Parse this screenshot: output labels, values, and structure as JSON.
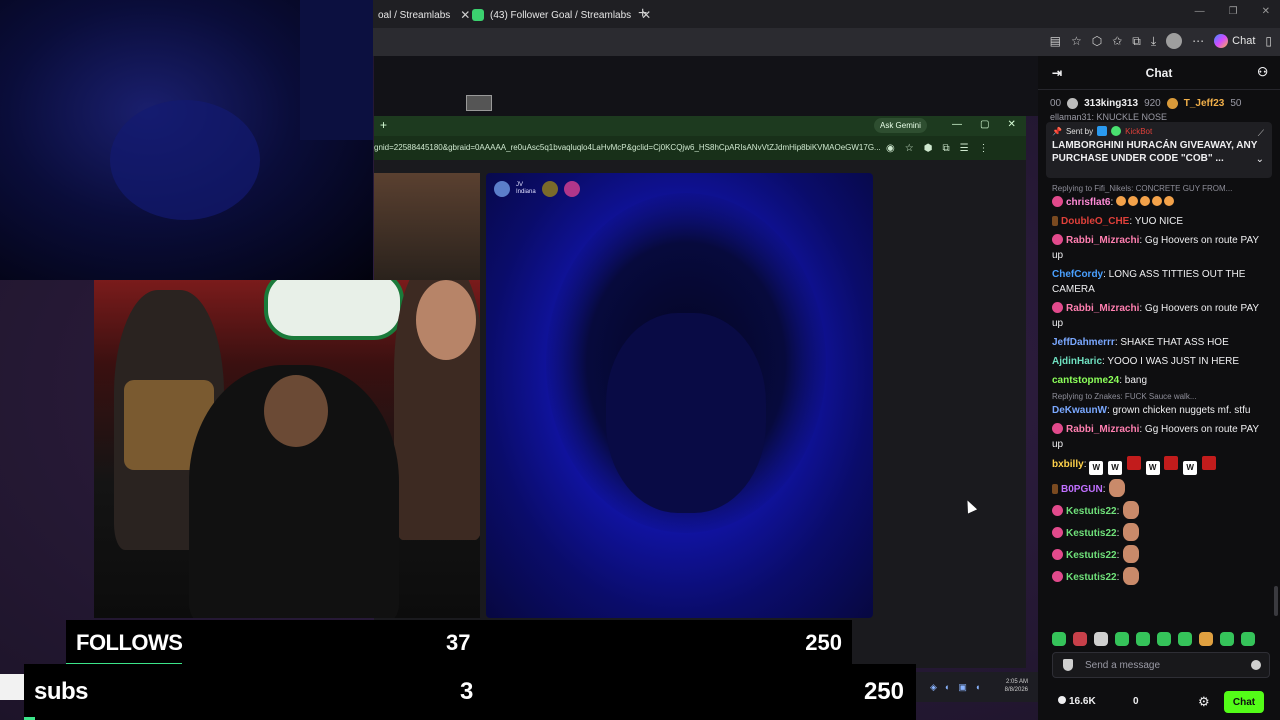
{
  "browser": {
    "tabs": [
      {
        "label": "oal / Streamlabs"
      },
      {
        "label": "(43) Follower Goal / Streamlabs"
      }
    ],
    "copilot_label": "Chat"
  },
  "inner_browser": {
    "gemini_label": "Ask Gemini",
    "url": "gnid=22588445180&gbraid=0AAAAA_re0uAsc5q1bvaqluqlo4LaHvMcP&gclid=Cj0KCQjw6_HS8hCpARIsANvVtZJdmHip8biKVMAOeGW17G..."
  },
  "video_right": {
    "name": "JV",
    "sub": "Indiana"
  },
  "goals": {
    "follows": {
      "label": "FOLLOWS",
      "current": "37",
      "target": "250",
      "progress": 0.148
    },
    "subs": {
      "label": "subs",
      "current": "3",
      "target": "250",
      "progress": 0.012
    }
  },
  "taskbar": {
    "time": "2:05 AM",
    "date": "8/8/2026"
  },
  "chat": {
    "title": "Chat",
    "leaders": [
      {
        "rank": "00"
      },
      {
        "name": "313king313",
        "points": "920"
      },
      {
        "name": "T_Jeff23",
        "points": "50"
      }
    ],
    "partial_line": "ellaman31: KNUCKLE NOSE",
    "pinned": {
      "sent_by_label": "Sent by",
      "sent_by_name": "KickBot",
      "text": "LAMBORGHINI HURACÁN GIVEAWAY, ANY PURCHASE UNDER CODE \"COB\" ..."
    },
    "messages": [
      {
        "reply": "Replying to Fifi_Nikels: CONCRETE GUY FROM...",
        "user": "chrisflat6",
        "color": "#ff8ad6",
        "text": "",
        "badge": "pink",
        "emotes": 5
      },
      {
        "user": "DoubleO_CHE",
        "color": "#e0403a",
        "text": ": YUO NICE",
        "badge": "tiny"
      },
      {
        "user": "Rabbi_Mizrachi",
        "color": "#ff7fb0",
        "text": ": Gg Hoovers on route PAY up",
        "badge": "pink"
      },
      {
        "user": "ChefCordy",
        "color": "#4aa0ff",
        "text": ": LONG ASS TITTIES OUT THE CAMERA",
        "badge": ""
      },
      {
        "user": "Rabbi_Mizrachi",
        "color": "#ff7fb0",
        "text": ": Gg Hoovers on route PAY up",
        "badge": "pink"
      },
      {
        "user": "JeffDahmerrr",
        "color": "#7aa8ff",
        "text": ": SHAKE THAT ASS HOE",
        "badge": ""
      },
      {
        "user": "AjdinHaric",
        "color": "#6fe0c0",
        "text": ": YOOO I WAS JUST IN HERE",
        "badge": ""
      },
      {
        "user": "cantstopme24",
        "color": "#8cff5a",
        "text": ": bang",
        "badge": ""
      },
      {
        "reply": "Replying to Znakes: FUCK Sauce walk...",
        "user": "DeKwaunW",
        "color": "#7aa8ff",
        "text": ": grown chicken nuggets mf. stfu",
        "badge": ""
      },
      {
        "user": "Rabbi_Mizrachi",
        "color": "#ff7fb0",
        "text": ": Gg Hoovers on route PAY up",
        "badge": "pink"
      },
      {
        "user": "bxbilly",
        "color": "#ffd24a",
        "text": ":",
        "badge": "",
        "wemotes": true
      },
      {
        "user": "B0PGUN",
        "color": "#c070ff",
        "text": ":",
        "badge": "tiny",
        "face": true
      },
      {
        "user": "Kestutis22",
        "color": "#6fe07a",
        "text": ":",
        "badge": "pink",
        "face": true
      },
      {
        "user": "Kestutis22",
        "color": "#6fe07a",
        "text": ":",
        "badge": "pink",
        "face": true
      },
      {
        "user": "Kestutis22",
        "color": "#6fe07a",
        "text": ":",
        "badge": "pink",
        "face": true
      },
      {
        "user": "Kestutis22",
        "color": "#6fe07a",
        "text": ":",
        "badge": "pink",
        "face": true
      }
    ],
    "input_placeholder": "Send a message",
    "viewer_count": "16.6K",
    "zero_count": "0",
    "chat_button": "Chat"
  },
  "colors": {
    "accent": "#53fc18",
    "goal_fill": "#3ce58a"
  }
}
